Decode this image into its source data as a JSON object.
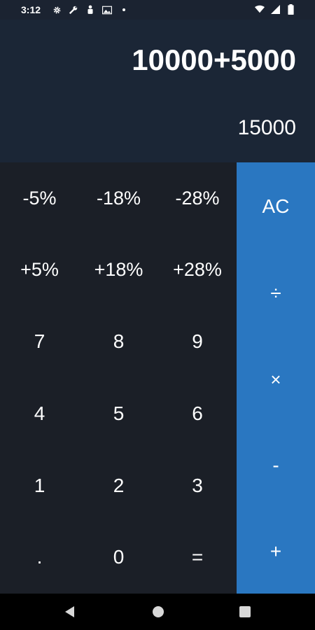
{
  "status_bar": {
    "time": "3:12",
    "left_icons": [
      "gear-icon",
      "wrench-icon",
      "person-icon",
      "image-icon",
      "dot-icon"
    ],
    "right_icons": [
      "wifi-icon",
      "signal-icon",
      "battery-icon"
    ]
  },
  "display": {
    "expression": "10000+5000",
    "result": "15000"
  },
  "keypad": {
    "row1": [
      "-5%",
      "-18%",
      "-28%"
    ],
    "row2": [
      "+5%",
      "+18%",
      "+28%"
    ],
    "row3": [
      "7",
      "8",
      "9"
    ],
    "row4": [
      "4",
      "5",
      "6"
    ],
    "row5": [
      "1",
      "2",
      "3"
    ],
    "row6": [
      ".",
      "0",
      "="
    ]
  },
  "operators": {
    "clear": "AC",
    "divide": "÷",
    "multiply": "×",
    "subtract": "-",
    "add": "+"
  },
  "colors": {
    "display_bg": "#1b2636",
    "keypad_bg": "#1b1f27",
    "operator_bg": "#2a77c1"
  },
  "nav_bar": {
    "buttons": [
      "back-icon",
      "home-icon",
      "recents-icon"
    ]
  }
}
